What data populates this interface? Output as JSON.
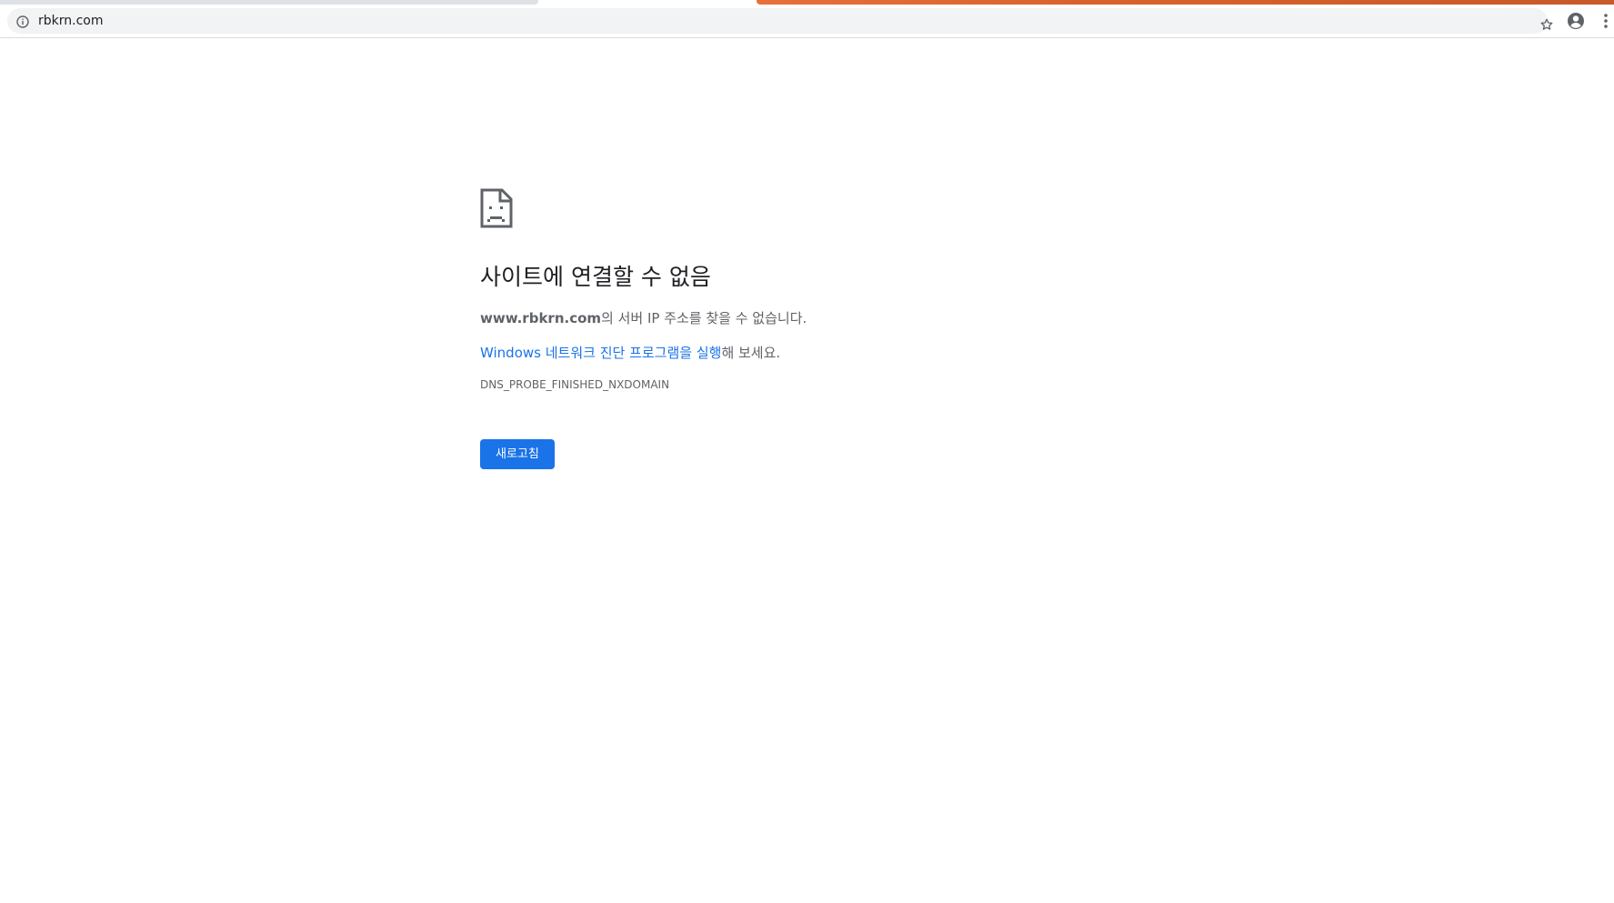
{
  "browser": {
    "url": "rbkrn.com",
    "tab_accent_color": "#e8703a"
  },
  "icons": {
    "info": "info-icon",
    "star": "star-icon",
    "profile": "profile-icon",
    "menu": "menu-icon",
    "error": "sad-page-icon"
  },
  "error": {
    "title": "사이트에 연결할 수 없음",
    "host": "www.rbkrn.com",
    "host_suffix": "의 서버 IP 주소를 찾을 수 없습니다.",
    "suggestion_link": "Windows 네트워크 진단 프로그램을 실행",
    "suggestion_suffix": "해 보세요.",
    "code": "DNS_PROBE_FINISHED_NXDOMAIN",
    "reload_label": "새로고침"
  },
  "colors": {
    "link": "#1a73e8",
    "button": "#1a73e8"
  }
}
